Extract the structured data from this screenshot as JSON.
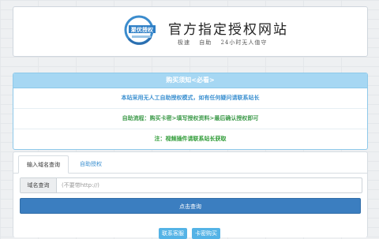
{
  "header": {
    "logo_text": "聚优授权",
    "title": "官方指定授权网站",
    "features": [
      "极速",
      "自助",
      "24小时无人值守"
    ]
  },
  "notice": {
    "title": "购买须知<必看>",
    "lines": [
      "本站采用无人工自助授权模式，如有任何疑问请联系站长",
      "自助流程：购买卡密>填写授权资料>最后确认授权即可",
      "注：视频插件请联系站长获取"
    ]
  },
  "tabs": [
    {
      "label": "输入域名查询",
      "active": true
    },
    {
      "label": "自助授权",
      "active": false
    }
  ],
  "form": {
    "addon_label": "域名查询",
    "placeholder": "(不要带http://)",
    "value": "",
    "submit_label": "点击查询"
  },
  "buttons": {
    "contact": "联系客服",
    "buy_card": "卡密购买"
  },
  "colors": {
    "accent": "#3b7ec0",
    "notice_head": "#a6d7f3",
    "link_blue": "#3a8fd0",
    "green": "#2c9a34"
  }
}
